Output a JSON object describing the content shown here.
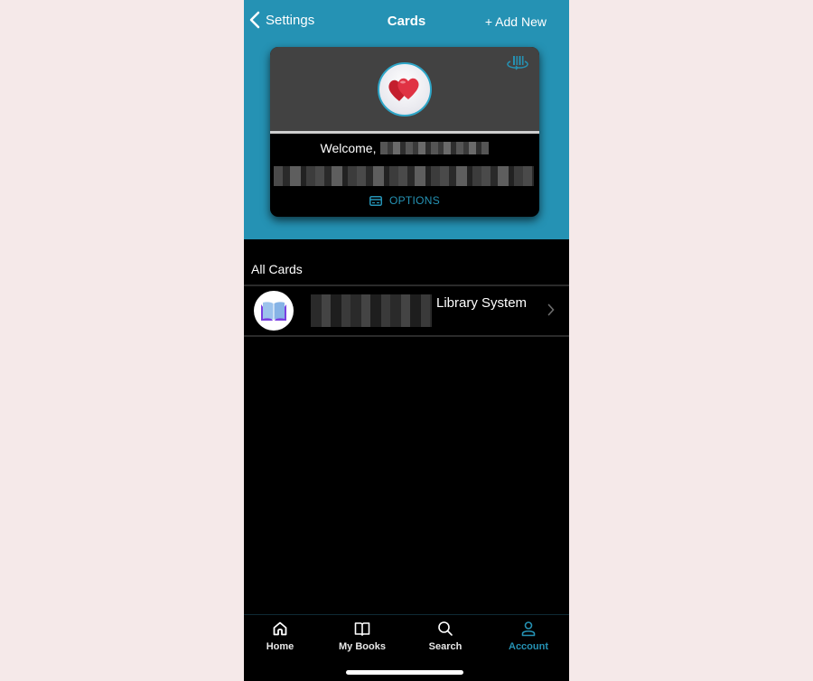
{
  "navbar": {
    "back_label": "Settings",
    "title": "Cards",
    "add_label": "+ Add New"
  },
  "card": {
    "welcome_label": "Welcome,",
    "options_label": "OPTIONS",
    "logo_icon": "hearts-icon",
    "barcode_icon": "barcode-rotate-icon",
    "name_redacted": true,
    "number_redacted": true
  },
  "all_cards": {
    "title": "All Cards",
    "items": [
      {
        "name": "Library System",
        "logo_icon": "book-icon",
        "id_redacted": true
      }
    ]
  },
  "tabbar": {
    "tabs": [
      {
        "label": "Home",
        "icon": "home-icon",
        "active": false
      },
      {
        "label": "My Books",
        "icon": "book-open-icon",
        "active": false
      },
      {
        "label": "Search",
        "icon": "search-icon",
        "active": false
      },
      {
        "label": "Account",
        "icon": "user-icon",
        "active": true
      }
    ]
  },
  "colors": {
    "accent": "#2592b4",
    "card_header": "#424242",
    "background": "#000000"
  }
}
